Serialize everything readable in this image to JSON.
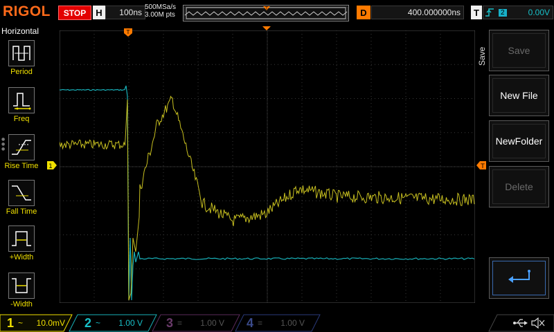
{
  "header": {
    "brand": "RIGOL",
    "run_state": "STOP",
    "horizontal_key": "H",
    "timebase": "100ns",
    "sample_rate": "500MSa/s",
    "memory_depth": "3.00M pts",
    "delay_key": "D",
    "delay": "400.000000ns",
    "trigger_key": "T",
    "trigger_source": "2",
    "trigger_level": "0.00V"
  },
  "left_menu": {
    "title": "Horizontal",
    "items": [
      {
        "label": "Period"
      },
      {
        "label": "Freq"
      },
      {
        "label": "Rise Time"
      },
      {
        "label": "Fall Time"
      },
      {
        "label": "+Width"
      },
      {
        "label": "-Width"
      }
    ]
  },
  "right_menu": {
    "title": "Save",
    "buttons": [
      {
        "label": "Save",
        "enabled": false
      },
      {
        "label": "New File",
        "enabled": true
      },
      {
        "label": "NewFolder",
        "enabled": true
      },
      {
        "label": "Delete",
        "enabled": false
      }
    ]
  },
  "channels": [
    {
      "num": "1",
      "coupling": "~",
      "scale": "10.0mV",
      "color": "#f0e000",
      "active": true
    },
    {
      "num": "2",
      "coupling": "~",
      "scale": "1.00 V",
      "color": "#00c8d0",
      "active": true
    },
    {
      "num": "3",
      "coupling": "=",
      "scale": "1.00 V",
      "color": "#c040c0",
      "active": false
    },
    {
      "num": "4",
      "coupling": "=",
      "scale": "1.00 V",
      "color": "#4060ff",
      "active": false
    }
  ],
  "colors": {
    "ch1": "#d8d020",
    "ch2": "#18b0b8",
    "trigger": "#ff7a00",
    "grid": "#3a3a3a",
    "brand": "#ff6a1a"
  },
  "icons": {
    "trigger_edge": "rising-edge-icon",
    "usb": "usb-icon",
    "sound": "speaker-muted-icon",
    "enter": "enter-arrow-icon"
  }
}
